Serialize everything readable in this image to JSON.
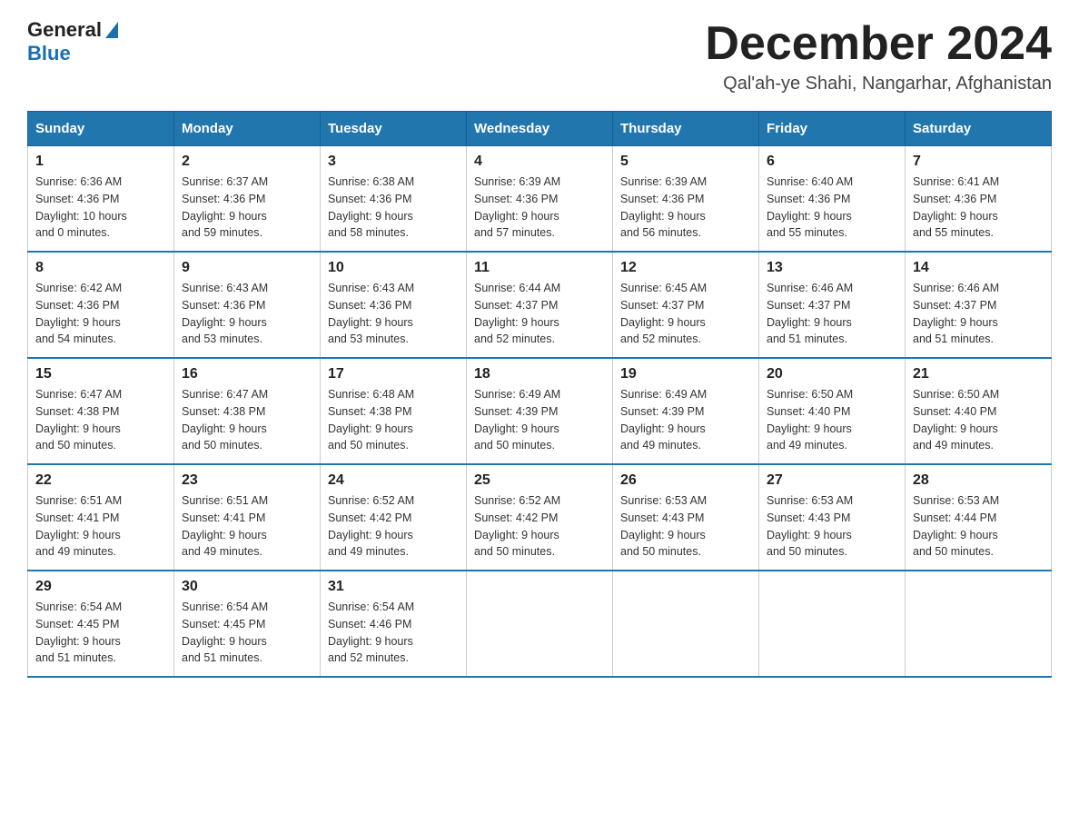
{
  "logo": {
    "general": "General",
    "blue": "Blue"
  },
  "title": {
    "month_year": "December 2024",
    "location": "Qal'ah-ye Shahi, Nangarhar, Afghanistan"
  },
  "days_of_week": [
    "Sunday",
    "Monday",
    "Tuesday",
    "Wednesday",
    "Thursday",
    "Friday",
    "Saturday"
  ],
  "weeks": [
    [
      {
        "day": "1",
        "sunrise": "6:36 AM",
        "sunset": "4:36 PM",
        "daylight": "10 hours and 0 minutes."
      },
      {
        "day": "2",
        "sunrise": "6:37 AM",
        "sunset": "4:36 PM",
        "daylight": "9 hours and 59 minutes."
      },
      {
        "day": "3",
        "sunrise": "6:38 AM",
        "sunset": "4:36 PM",
        "daylight": "9 hours and 58 minutes."
      },
      {
        "day": "4",
        "sunrise": "6:39 AM",
        "sunset": "4:36 PM",
        "daylight": "9 hours and 57 minutes."
      },
      {
        "day": "5",
        "sunrise": "6:39 AM",
        "sunset": "4:36 PM",
        "daylight": "9 hours and 56 minutes."
      },
      {
        "day": "6",
        "sunrise": "6:40 AM",
        "sunset": "4:36 PM",
        "daylight": "9 hours and 55 minutes."
      },
      {
        "day": "7",
        "sunrise": "6:41 AM",
        "sunset": "4:36 PM",
        "daylight": "9 hours and 55 minutes."
      }
    ],
    [
      {
        "day": "8",
        "sunrise": "6:42 AM",
        "sunset": "4:36 PM",
        "daylight": "9 hours and 54 minutes."
      },
      {
        "day": "9",
        "sunrise": "6:43 AM",
        "sunset": "4:36 PM",
        "daylight": "9 hours and 53 minutes."
      },
      {
        "day": "10",
        "sunrise": "6:43 AM",
        "sunset": "4:36 PM",
        "daylight": "9 hours and 53 minutes."
      },
      {
        "day": "11",
        "sunrise": "6:44 AM",
        "sunset": "4:37 PM",
        "daylight": "9 hours and 52 minutes."
      },
      {
        "day": "12",
        "sunrise": "6:45 AM",
        "sunset": "4:37 PM",
        "daylight": "9 hours and 52 minutes."
      },
      {
        "day": "13",
        "sunrise": "6:46 AM",
        "sunset": "4:37 PM",
        "daylight": "9 hours and 51 minutes."
      },
      {
        "day": "14",
        "sunrise": "6:46 AM",
        "sunset": "4:37 PM",
        "daylight": "9 hours and 51 minutes."
      }
    ],
    [
      {
        "day": "15",
        "sunrise": "6:47 AM",
        "sunset": "4:38 PM",
        "daylight": "9 hours and 50 minutes."
      },
      {
        "day": "16",
        "sunrise": "6:47 AM",
        "sunset": "4:38 PM",
        "daylight": "9 hours and 50 minutes."
      },
      {
        "day": "17",
        "sunrise": "6:48 AM",
        "sunset": "4:38 PM",
        "daylight": "9 hours and 50 minutes."
      },
      {
        "day": "18",
        "sunrise": "6:49 AM",
        "sunset": "4:39 PM",
        "daylight": "9 hours and 50 minutes."
      },
      {
        "day": "19",
        "sunrise": "6:49 AM",
        "sunset": "4:39 PM",
        "daylight": "9 hours and 49 minutes."
      },
      {
        "day": "20",
        "sunrise": "6:50 AM",
        "sunset": "4:40 PM",
        "daylight": "9 hours and 49 minutes."
      },
      {
        "day": "21",
        "sunrise": "6:50 AM",
        "sunset": "4:40 PM",
        "daylight": "9 hours and 49 minutes."
      }
    ],
    [
      {
        "day": "22",
        "sunrise": "6:51 AM",
        "sunset": "4:41 PM",
        "daylight": "9 hours and 49 minutes."
      },
      {
        "day": "23",
        "sunrise": "6:51 AM",
        "sunset": "4:41 PM",
        "daylight": "9 hours and 49 minutes."
      },
      {
        "day": "24",
        "sunrise": "6:52 AM",
        "sunset": "4:42 PM",
        "daylight": "9 hours and 49 minutes."
      },
      {
        "day": "25",
        "sunrise": "6:52 AM",
        "sunset": "4:42 PM",
        "daylight": "9 hours and 50 minutes."
      },
      {
        "day": "26",
        "sunrise": "6:53 AM",
        "sunset": "4:43 PM",
        "daylight": "9 hours and 50 minutes."
      },
      {
        "day": "27",
        "sunrise": "6:53 AM",
        "sunset": "4:43 PM",
        "daylight": "9 hours and 50 minutes."
      },
      {
        "day": "28",
        "sunrise": "6:53 AM",
        "sunset": "4:44 PM",
        "daylight": "9 hours and 50 minutes."
      }
    ],
    [
      {
        "day": "29",
        "sunrise": "6:54 AM",
        "sunset": "4:45 PM",
        "daylight": "9 hours and 51 minutes."
      },
      {
        "day": "30",
        "sunrise": "6:54 AM",
        "sunset": "4:45 PM",
        "daylight": "9 hours and 51 minutes."
      },
      {
        "day": "31",
        "sunrise": "6:54 AM",
        "sunset": "4:46 PM",
        "daylight": "9 hours and 52 minutes."
      },
      null,
      null,
      null,
      null
    ]
  ],
  "labels": {
    "sunrise": "Sunrise: ",
    "sunset": "Sunset: ",
    "daylight": "Daylight: "
  }
}
